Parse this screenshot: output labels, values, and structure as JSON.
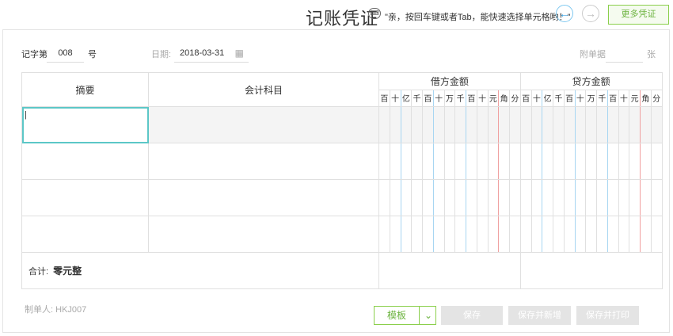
{
  "header": {
    "title": "记账凭证",
    "kbd_icon": "keyboard-icon",
    "hint": "\"亲，按回车键或者Tab，能快速选择单元格哟！\"",
    "prev_icon": "←",
    "next_icon": "→",
    "more_button": "更多凭证"
  },
  "meta": {
    "voucher_word_label": "记字第",
    "voucher_number": "008",
    "voucher_number_suffix": "号",
    "date_label": "日期:",
    "date_value": "2018-03-31",
    "attachments_label": "附单据",
    "attachments_value": "",
    "attachments_unit": "张"
  },
  "table": {
    "col_summary": "摘要",
    "col_account": "会计科目",
    "debit_header": "借方金额",
    "credit_header": "贷方金额",
    "digit_units": [
      "百",
      "十",
      "亿",
      "千",
      "百",
      "十",
      "万",
      "千",
      "百",
      "十",
      "元",
      "角",
      "分"
    ],
    "total_label": "合计:",
    "total_value": "零元整",
    "cursor": "|"
  },
  "footer": {
    "maker_label": "制单人:",
    "maker_value": "HKJ007",
    "template_button": "模板",
    "template_dropdown_icon": "chevron-down",
    "save_button": "保存",
    "save_new_button": "保存并新增",
    "save_print_button": "保存并打印"
  },
  "colors": {
    "accent_green": "#6cb33f",
    "accent_blue": "#3aa3e3",
    "active_cell": "#5cc7c7",
    "disabled_button": "#e4e4e4"
  }
}
